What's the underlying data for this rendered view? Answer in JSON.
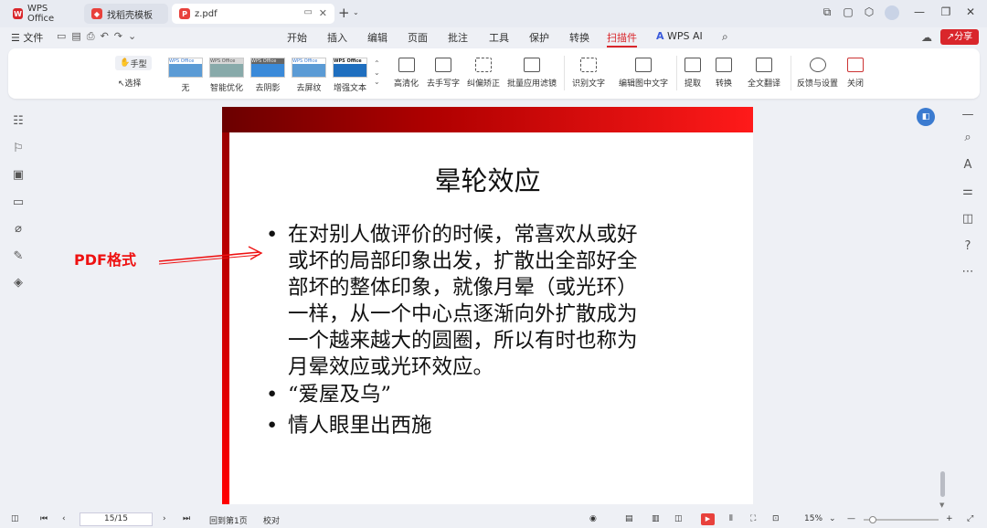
{
  "tabs": [
    {
      "label": "WPS Office"
    },
    {
      "label": "找稻壳模板"
    },
    {
      "label": "z.pdf"
    }
  ],
  "menu": {
    "file": "文件",
    "items": [
      "开始",
      "插入",
      "编辑",
      "页面",
      "批注",
      "工具",
      "保护",
      "转换",
      "扫描件",
      "WPS AI"
    ],
    "share": "分享"
  },
  "ribbon": {
    "hand": "手型",
    "select": "选择",
    "thumbs": [
      "无",
      "智能优化",
      "去阴影",
      "去屏纹",
      "增强文本"
    ],
    "thumb_brand": "WPS Office",
    "tools": [
      "高清化",
      "去手写字",
      "纠偏矫正",
      "批量应用滤镜",
      "识别文字",
      "编辑图中文字",
      "提取",
      "转换",
      "全文翻译",
      "反馈与设置",
      "关闭"
    ]
  },
  "document": {
    "title": "晕轮效应",
    "bullets": [
      "在对别人做评价的时候，常喜欢从或好或坏的局部印象出发，扩散出全部好全部坏的整体印象，就像月晕（或光环）一样，从一个中心点逐渐向外扩散成为一个越来越大的圆圈，所以有时也称为月晕效应或光环效应。",
      "“爱屋及乌”",
      "情人眼里出西施"
    ],
    "bullet_lines": [
      [
        "在对别人做评价的时候，常喜欢从或好",
        "或坏的局部印象出发，扩散出全部好全",
        "部坏的整体印象，就像月晕（或光环）",
        "一样，从一个中心点逐渐向外扩散成为",
        "一个越来越大的圆圈，所以有时也称为",
        "月晕效应或光环效应。"
      ]
    ]
  },
  "annotation": {
    "label": "PDF格式",
    "color": "#ee1111"
  },
  "status": {
    "page": "15/15",
    "back_to_first": "回到第1页",
    "proofread": "校对",
    "zoom": "15%"
  },
  "colors": {
    "accent": "#d9262b",
    "ai_blue": "#3b5bdb"
  }
}
